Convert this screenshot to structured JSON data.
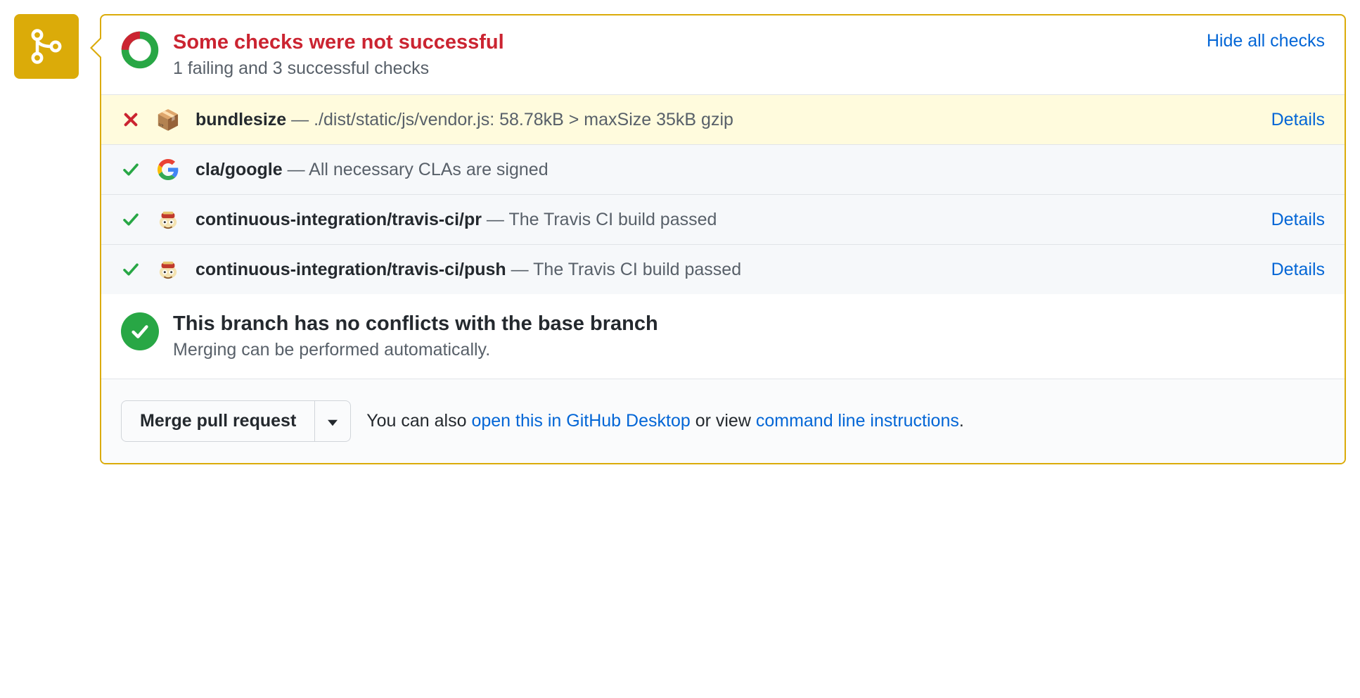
{
  "status": {
    "title": "Some checks were not successful",
    "subtitle": "1 failing and 3 successful checks",
    "hide_link": "Hide all checks"
  },
  "checks": [
    {
      "status": "fail",
      "icon": "package-icon",
      "name": "bundlesize",
      "sep": " — ",
      "desc": "./dist/static/js/vendor.js: 58.78kB > maxSize 35kB gzip",
      "details": "Details"
    },
    {
      "status": "pass",
      "icon": "google-icon",
      "name": "cla/google",
      "sep": " — ",
      "desc": "All necessary CLAs are signed",
      "details": ""
    },
    {
      "status": "pass",
      "icon": "travis-icon",
      "name": "continuous-integration/travis-ci/pr",
      "sep": " — ",
      "desc": "The Travis CI build passed",
      "details": "Details"
    },
    {
      "status": "pass",
      "icon": "travis-icon",
      "name": "continuous-integration/travis-ci/push",
      "sep": " — ",
      "desc": "The Travis CI build passed",
      "details": "Details"
    }
  ],
  "merge": {
    "title": "This branch has no conflicts with the base branch",
    "subtitle": "Merging can be performed automatically."
  },
  "actions": {
    "merge_button": "Merge pull request",
    "hint_prefix": "You can also ",
    "hint_link1": "open this in GitHub Desktop",
    "hint_mid": " or view ",
    "hint_link2": "command line instructions",
    "hint_suffix": "."
  }
}
